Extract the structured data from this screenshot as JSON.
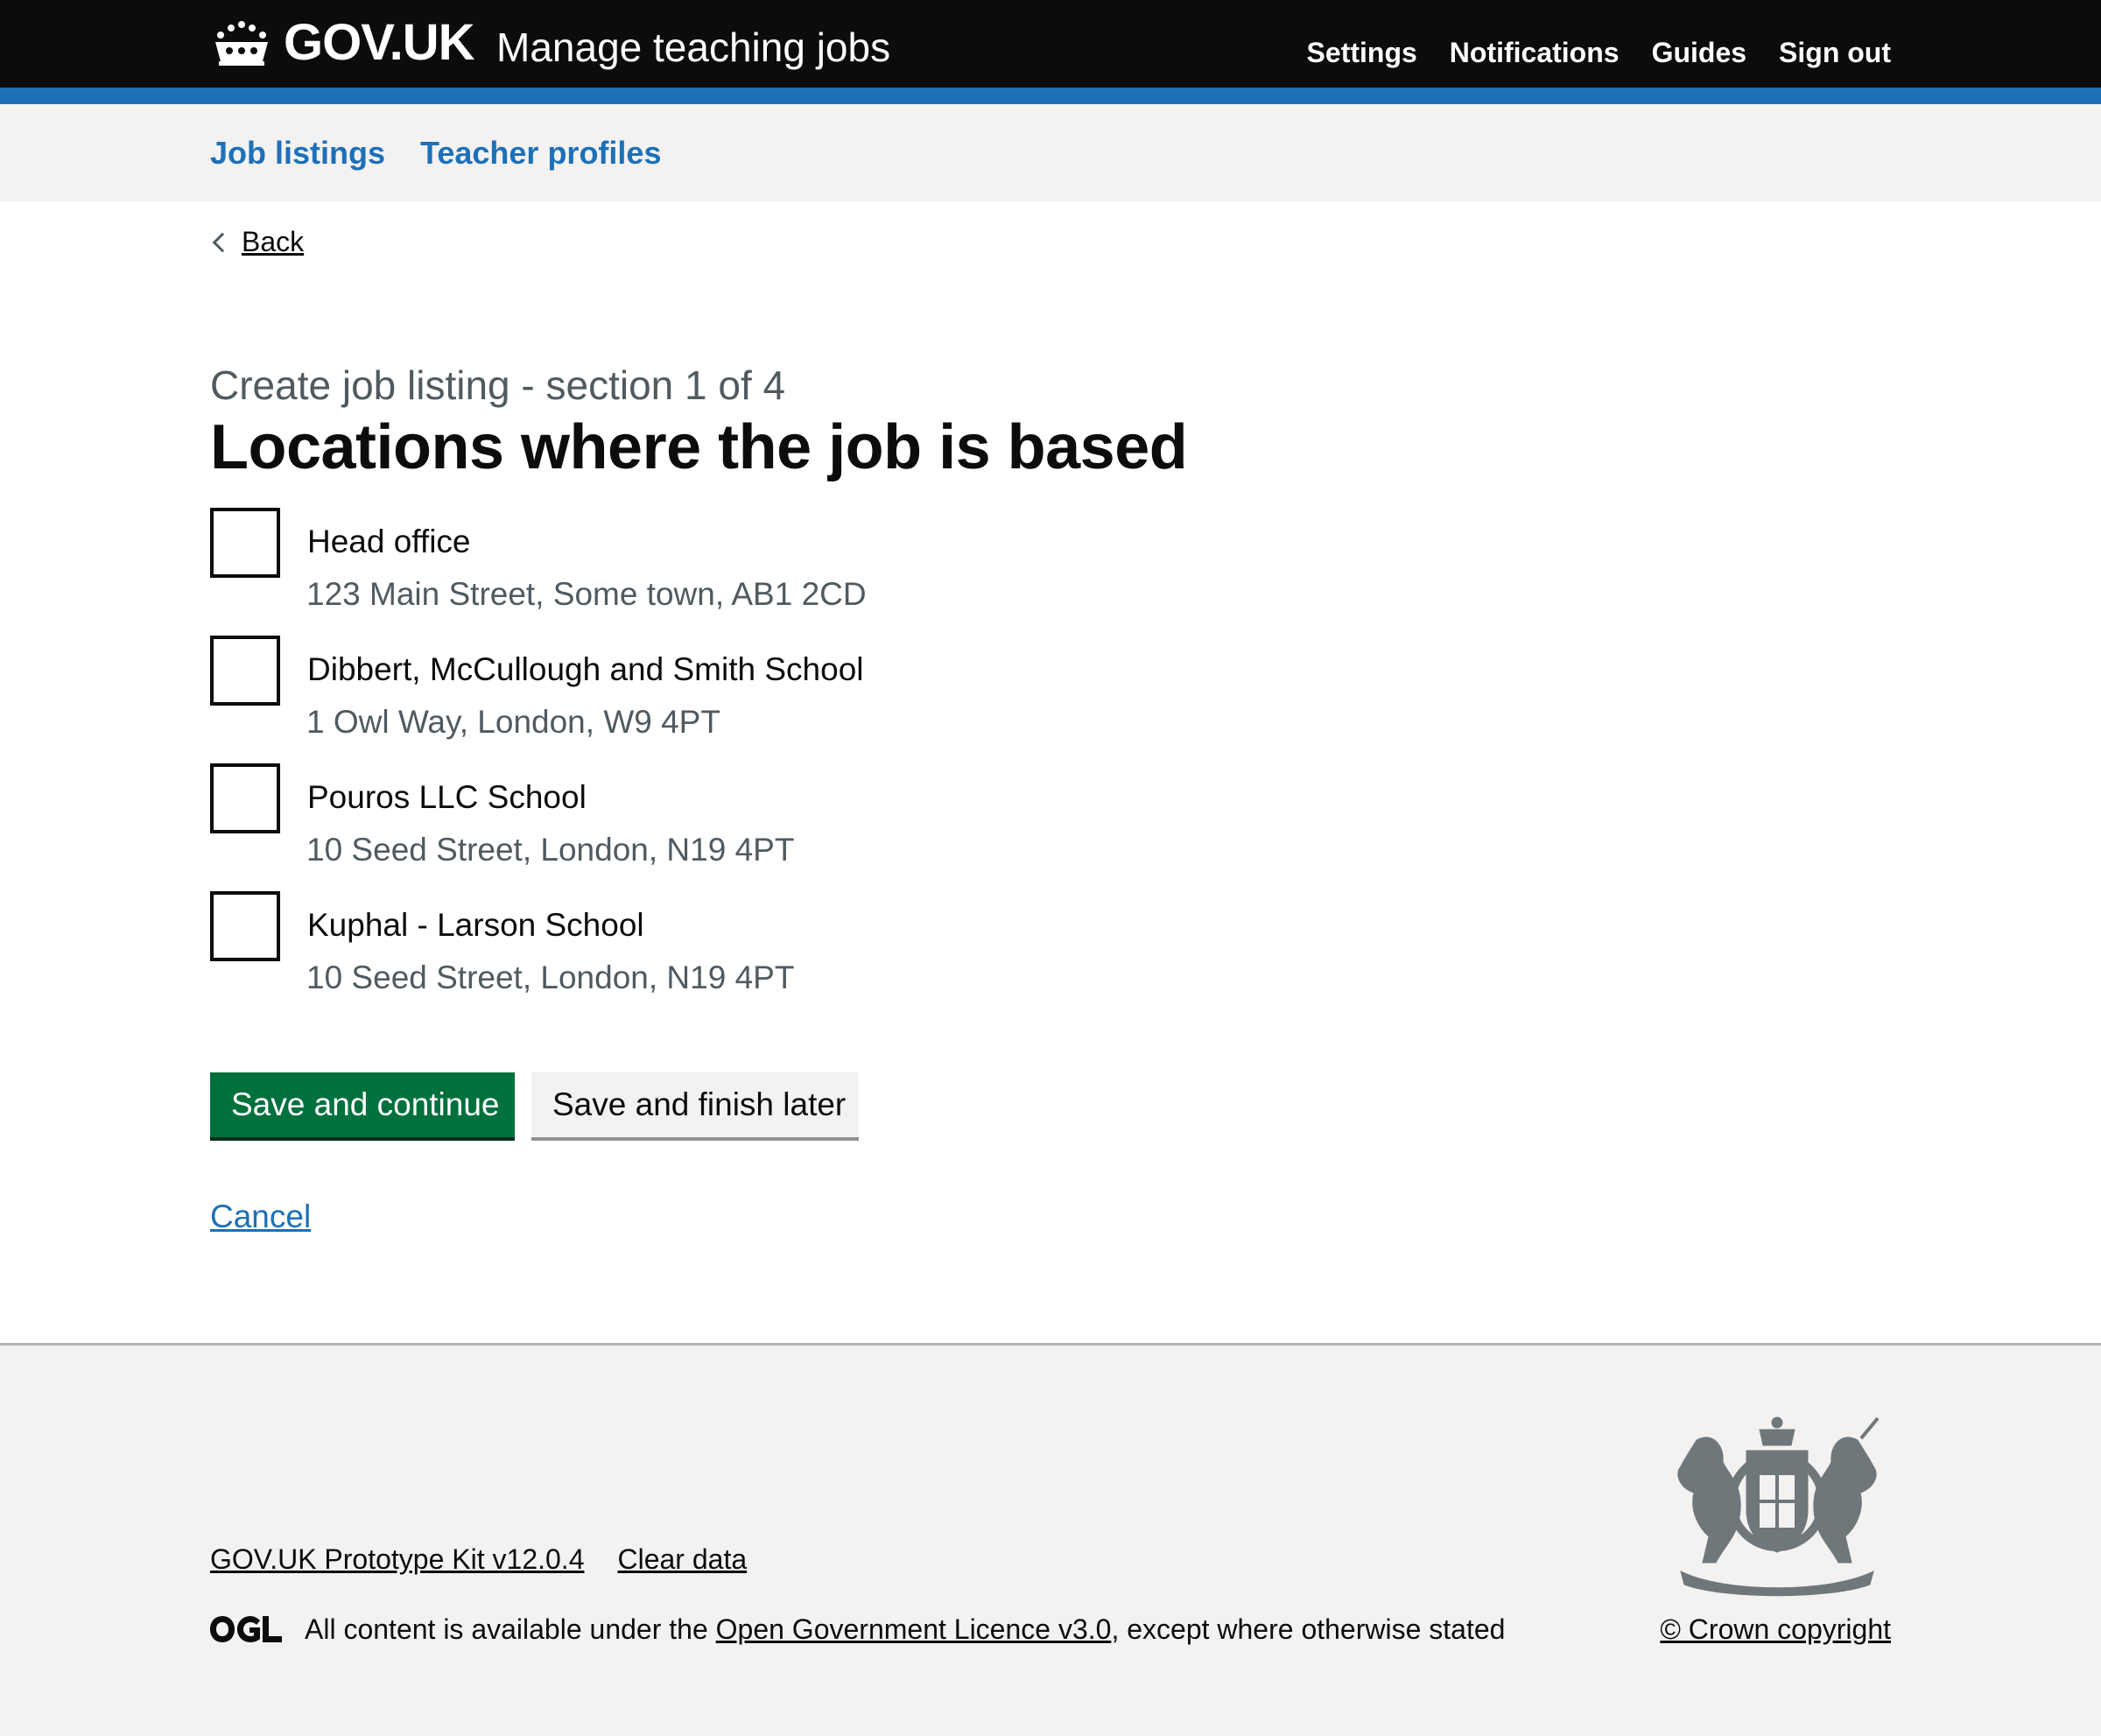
{
  "header": {
    "logo_text": "GOV.UK",
    "service_name": "Manage teaching jobs",
    "nav": [
      "Settings",
      "Notifications",
      "Guides",
      "Sign out"
    ]
  },
  "subnav": {
    "items": [
      "Job listings",
      "Teacher profiles"
    ]
  },
  "back_link": "Back",
  "form": {
    "caption": "Create job listing - section 1 of 4",
    "heading": "Locations where the job is based",
    "options": [
      {
        "label": "Head office",
        "hint": "123 Main Street, Some town, AB1 2CD",
        "checked": false
      },
      {
        "label": "Dibbert, McCullough and Smith School",
        "hint": "1 Owl Way, London, W9 4PT",
        "checked": false
      },
      {
        "label": "Pouros LLC School",
        "hint": "10 Seed Street, London, N19 4PT",
        "checked": false
      },
      {
        "label": "Kuphal - Larson School",
        "hint": "10 Seed Street, London, N19 4PT",
        "checked": false
      }
    ],
    "primary_button": "Save and continue",
    "secondary_button": "Save and finish later",
    "cancel": "Cancel"
  },
  "footer": {
    "links": [
      "GOV.UK Prototype Kit v12.0.4",
      "Clear data"
    ],
    "licence_prefix": "All content is available under the ",
    "licence_link": "Open Government Licence v3.0",
    "licence_suffix": ", except where otherwise stated",
    "copyright": "© Crown copyright"
  },
  "colors": {
    "header_bg": "#0b0c0c",
    "header_bar": "#1d70b8",
    "link": "#1d70b8",
    "primary_button": "#00703c",
    "secondary_button": "#f3f2f1",
    "footer_bg": "#f3f2f1",
    "hint_text": "#505a5f"
  }
}
